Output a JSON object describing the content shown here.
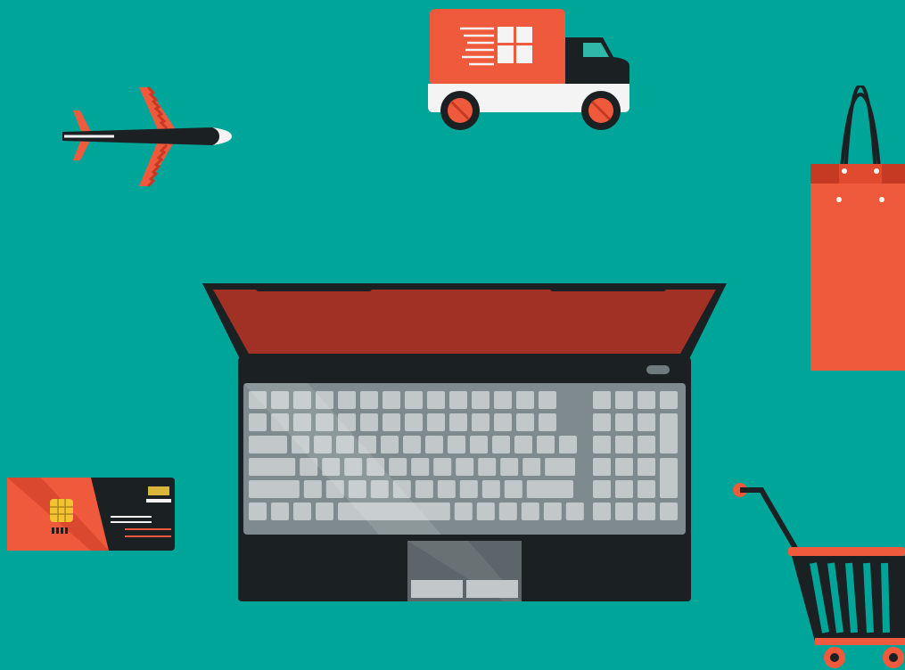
{
  "scene": {
    "description_tags": [
      "airplane-icon",
      "delivery-truck-icon",
      "shopping-bag-icon",
      "laptop-icon",
      "credit-card-icon",
      "shopping-cart-icon"
    ]
  },
  "colors": {
    "background": "#00A59A",
    "accent": "#EF5A3C",
    "accent_dark": "#C63A24",
    "screen": "#A23125",
    "dark": "#1B2023",
    "keyboard": "#7E8A8E",
    "key": "#C2C8CA",
    "white": "#F4F4F4",
    "chip": "#F2C230",
    "teal_window": "#2FB7A9"
  }
}
